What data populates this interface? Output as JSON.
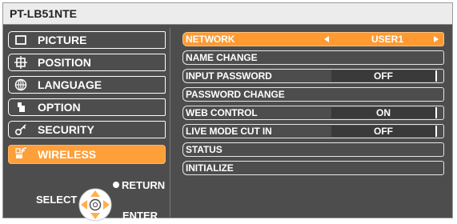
{
  "window": {
    "title": "PT-LB51NTE"
  },
  "sidebar": {
    "items": [
      {
        "label": "PICTURE",
        "icon": "picture-icon"
      },
      {
        "label": "POSITION",
        "icon": "position-icon"
      },
      {
        "label": "LANGUAGE",
        "icon": "language-globe-icon"
      },
      {
        "label": "OPTION",
        "icon": "option-wrench-icon"
      },
      {
        "label": "SECURITY",
        "icon": "security-key-icon"
      },
      {
        "label": "WIRELESS",
        "icon": "wireless-icon"
      }
    ],
    "active_index": 5
  },
  "help": {
    "return_label": "RETURN",
    "select_label": "SELECT",
    "enter_label": "ENTER"
  },
  "wireless_menu": {
    "rows": [
      {
        "label": "NETWORK",
        "value": "USER1"
      },
      {
        "label": "NAME CHANGE",
        "value": ""
      },
      {
        "label": "INPUT PASSWORD",
        "value": "OFF"
      },
      {
        "label": "PASSWORD CHANGE",
        "value": ""
      },
      {
        "label": "WEB CONTROL",
        "value": "ON"
      },
      {
        "label": "LIVE MODE CUT IN",
        "value": "OFF"
      },
      {
        "label": "STATUS",
        "value": ""
      },
      {
        "label": "INITIALIZE",
        "value": ""
      }
    ],
    "active_index": 0
  },
  "colors": {
    "accent": "#ff9f3a",
    "background": "#4d4d4d",
    "title_bar": "#ececec",
    "text": "#ffffff"
  }
}
